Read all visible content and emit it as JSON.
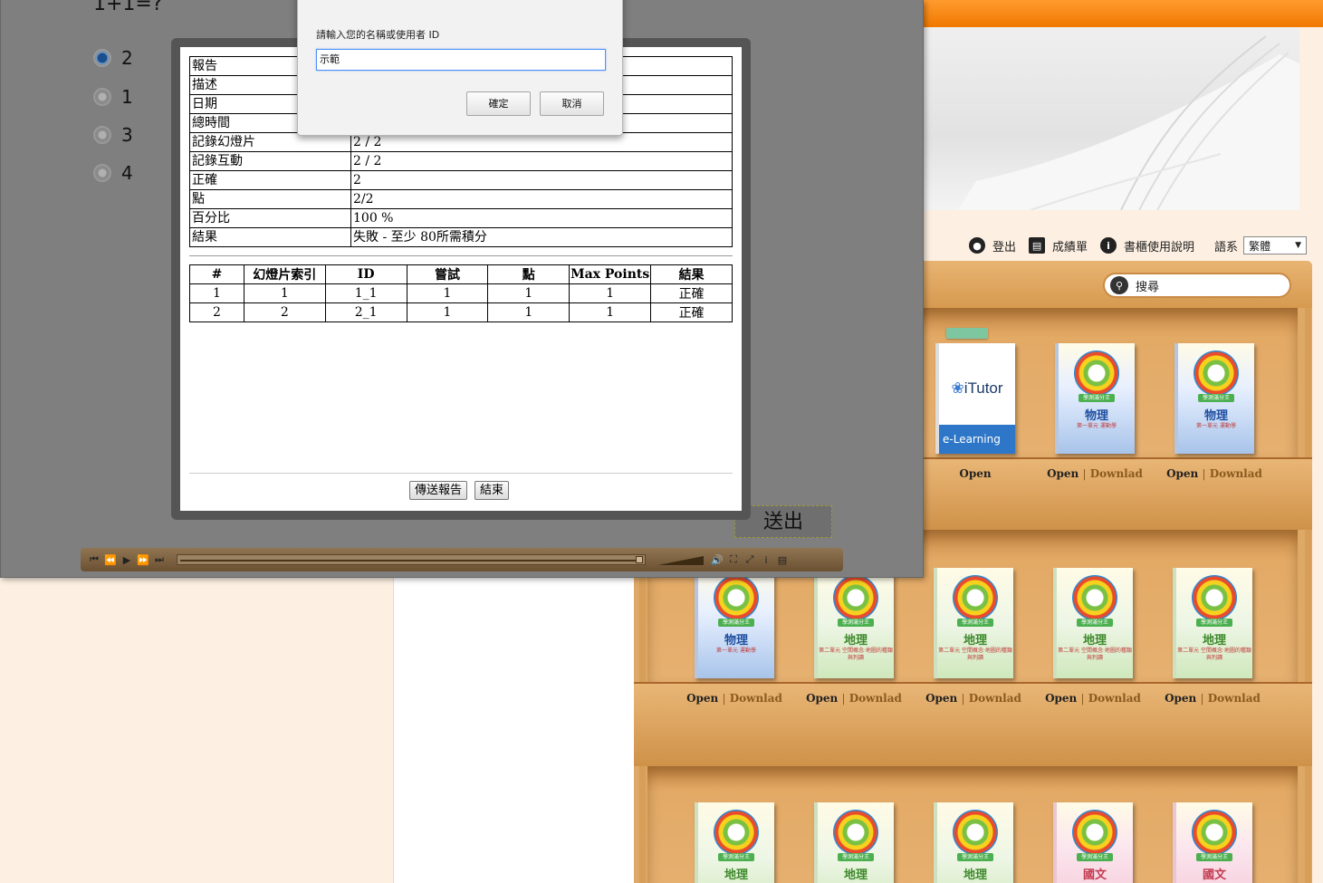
{
  "bookshelf": {
    "user_bar": {
      "logout": "登出",
      "report_card": "成績單",
      "help": "書櫃使用說明",
      "language_label": "語系",
      "language_value": "繁體"
    },
    "search": {
      "placeholder": "搜尋"
    },
    "books": [
      {
        "type": "itutor",
        "title": "iTutor",
        "subtitle": "e-Learning",
        "open": "Open",
        "download": ""
      },
      {
        "type": "phys",
        "subject": "物理",
        "chapter": "第一單元 運動學",
        "open": "Open",
        "download": "Downlad"
      },
      {
        "type": "phys",
        "subject": "物理",
        "chapter": "第一單元 運動學",
        "open": "Open",
        "download": "Downlad"
      },
      {
        "type": "phys",
        "subject": "物理",
        "chapter": "第一單元 運動學",
        "open": "Open",
        "download": "Downlad"
      },
      {
        "type": "geo",
        "subject": "地理",
        "chapter": "第二單元 空間概念‧地圖的種類與判讀",
        "open": "Open",
        "download": "Downlad"
      },
      {
        "type": "geo",
        "subject": "地理",
        "chapter": "第二單元 空間概念‧地圖的種類與判讀",
        "open": "Open",
        "download": "Downlad"
      },
      {
        "type": "geo",
        "subject": "地理",
        "chapter": "第二單元 空間概念‧地圖的種類與判讀",
        "open": "Open",
        "download": "Downlad"
      },
      {
        "type": "geo",
        "subject": "地理",
        "chapter": "第二單元 空間概念‧地圖的種類與判讀",
        "open": "Open",
        "download": "Downlad"
      },
      {
        "type": "geo",
        "subject": "地理",
        "chapter": "",
        "open": "",
        "download": ""
      },
      {
        "type": "geo",
        "subject": "地理",
        "chapter": "",
        "open": "",
        "download": ""
      },
      {
        "type": "geo",
        "subject": "地理",
        "chapter": "",
        "open": "",
        "download": ""
      },
      {
        "type": "chi",
        "subject": "國文",
        "chapter": "",
        "open": "",
        "download": ""
      },
      {
        "type": "chi",
        "subject": "國文",
        "chapter": "",
        "open": "",
        "download": ""
      }
    ],
    "badge": "學測滿分王",
    "link_separator": "|"
  },
  "player": {
    "question": "1+1=?",
    "options": [
      "2",
      "1",
      "3",
      "4"
    ],
    "selected_option": "2",
    "send_button": "送出",
    "controls": {
      "first": "⏮",
      "prev": "⏪",
      "play": "▶",
      "next": "⏩",
      "last": "⏭",
      "volume": "🔊",
      "fullscreen": "⛶",
      "fit": "⤢",
      "info": "i",
      "notes": "▤"
    },
    "progress": 0.98
  },
  "report": {
    "summary": [
      {
        "key": "報告",
        "value": ""
      },
      {
        "key": "描述",
        "value": ""
      },
      {
        "key": "日期",
        "value": ""
      },
      {
        "key": "總時間",
        "value": ""
      },
      {
        "key": "記錄幻燈片",
        "value": "2 / 2"
      },
      {
        "key": "記錄互動",
        "value": "2 / 2"
      },
      {
        "key": "正確",
        "value": "2"
      },
      {
        "key": "點",
        "value": "2/2"
      },
      {
        "key": "百分比",
        "value": "100 %"
      },
      {
        "key": "結果",
        "value": "失敗 - 至少 80所需積分"
      }
    ],
    "detail_headers": [
      "#",
      "幻燈片索引",
      "ID",
      "嘗試",
      "點",
      "Max Points",
      "結果"
    ],
    "detail_rows": [
      [
        "1",
        "1",
        "1_1",
        "1",
        "1",
        "1",
        "正確"
      ],
      [
        "2",
        "2",
        "2_1",
        "1",
        "1",
        "1",
        "正確"
      ]
    ],
    "send_report_button": "傳送報告",
    "end_button": "結束"
  },
  "prompt": {
    "title": "",
    "message": "請輸入您的名稱或使用者 ID",
    "input_value": "示範",
    "ok": "確定",
    "cancel": "取消"
  }
}
